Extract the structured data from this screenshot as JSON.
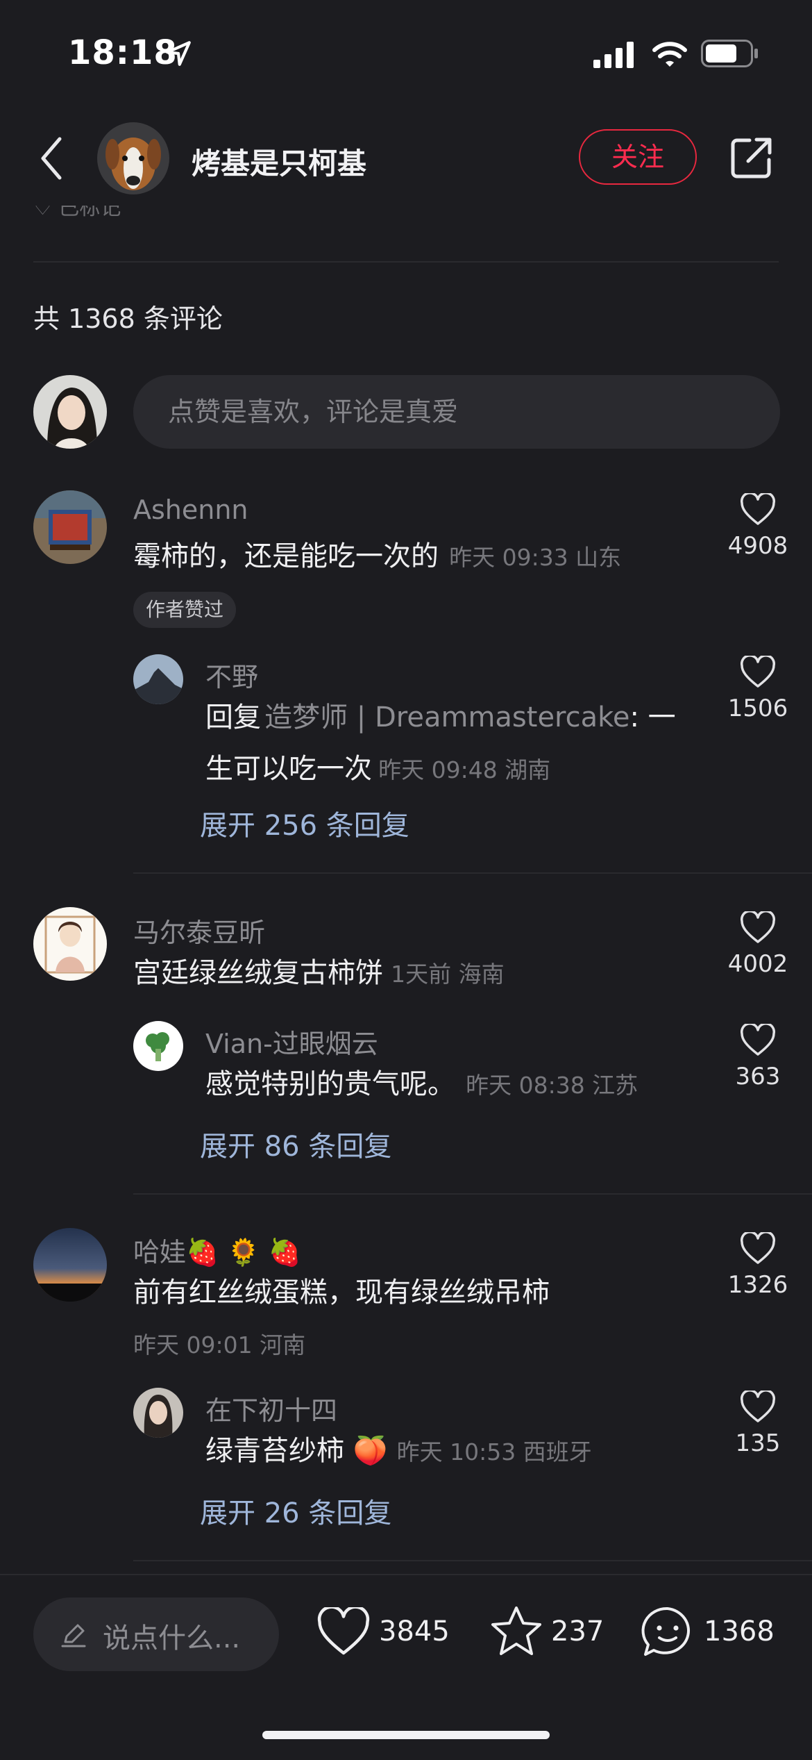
{
  "status_bar": {
    "time": "18:18"
  },
  "header": {
    "author_name": "烤基是只柯基",
    "follow_label": "关注",
    "cut_text": "♡ 已标记"
  },
  "comments_section": {
    "total_label": "共 1368 条评论",
    "input_placeholder": "点赞是喜欢，评论是真爱"
  },
  "comments": [
    {
      "name": "Ashennn",
      "text": "霉柿的，还是能吃一次的",
      "meta": "昨天 09:33 山东",
      "likes": "4908",
      "badge": "作者赞过",
      "reply": {
        "name": "不野",
        "reply_prefix": "回复",
        "reply_to": "造梦师 | Dreammastercake",
        "text": ": 一生可以吃一次",
        "meta": "昨天 09:48 湖南",
        "likes": "1506"
      },
      "expand_label": "展开 256 条回复"
    },
    {
      "name": "马尔泰豆昕",
      "text": "宫廷绿丝绒复古柿饼",
      "meta": "1天前 海南",
      "likes": "4002",
      "reply": {
        "name": "Vian-过眼烟云",
        "text": "感觉特别的贵气呢。",
        "meta": "昨天 08:38 江苏",
        "likes": "363"
      },
      "expand_label": "展开 86 条回复"
    },
    {
      "name": "哈娃🍓 🌻 🍓",
      "text": "前有红丝绒蛋糕，现有绿丝绒吊柿",
      "meta": "昨天 09:01 河南",
      "likes": "1326",
      "reply": {
        "name": "在下初十四",
        "text": "绿青苔纱柿 🍑",
        "meta": "昨天 10:53 西班牙",
        "likes": "135"
      },
      "expand_label": "展开 26 条回复"
    }
  ],
  "bottom_bar": {
    "say_placeholder": "说点什么...",
    "like_count": "3845",
    "fav_count": "237",
    "comment_count": "1368"
  },
  "icons": [
    "location-arrow-icon",
    "signal-icon",
    "wifi-icon",
    "battery-icon",
    "back-icon",
    "share-icon",
    "heart-icon",
    "pencil-icon",
    "star-icon",
    "chat-bubble-icon"
  ],
  "colors": {
    "background": "#1c1c20",
    "accent": "#ff2c4f",
    "link": "#9fb6da"
  }
}
